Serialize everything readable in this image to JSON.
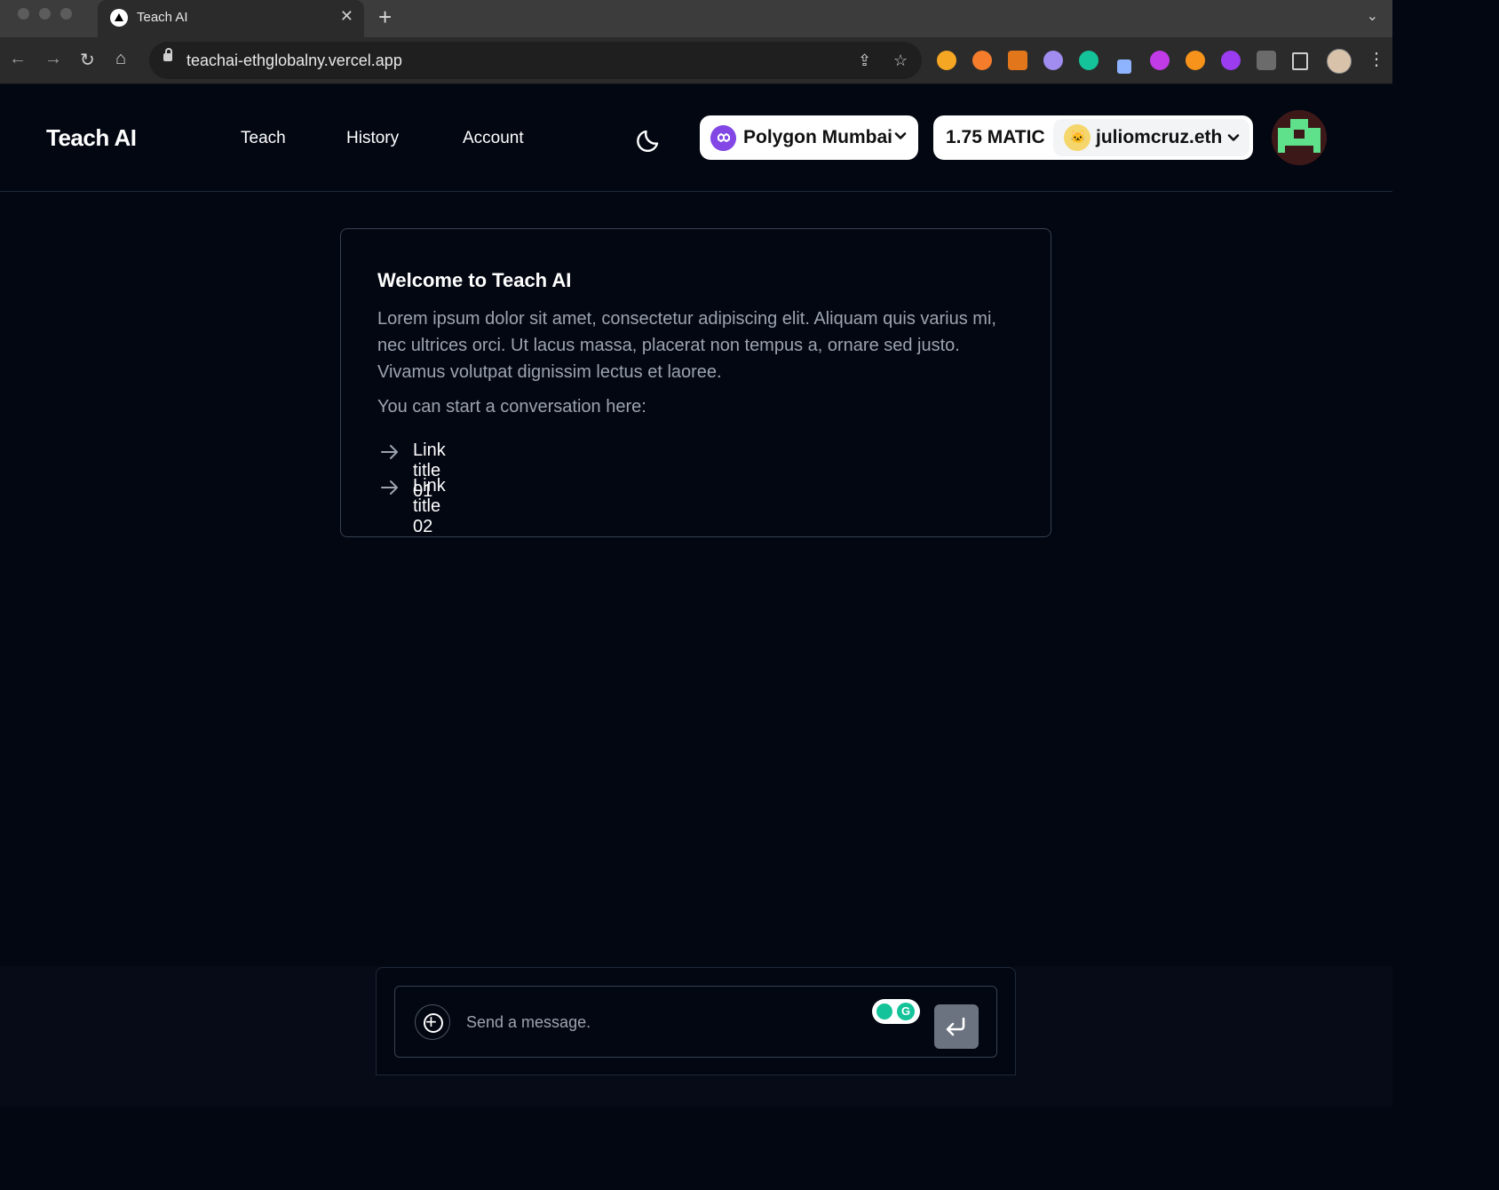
{
  "browser": {
    "tab_title": "Teach AI",
    "url": "teachai-ethglobalny.vercel.app"
  },
  "app": {
    "logo": "Teach AI",
    "nav": [
      {
        "label": "Teach"
      },
      {
        "label": "History"
      },
      {
        "label": "Account"
      }
    ],
    "network_label": "Polygon Mumbai",
    "balance": "1.75 MATIC",
    "ens_name": "juliomcruz.eth"
  },
  "welcome": {
    "title": "Welcome to Teach AI",
    "body": "Lorem ipsum dolor sit amet, consectetur adipiscing elit. Aliquam quis varius mi, nec ultrices orci. Ut lacus massa, placerat non tempus a, ornare sed justo. Vivamus volutpat dignissim lectus et laoree.",
    "prompt": "You can start a conversation here:",
    "links": [
      {
        "label": "Link title 01"
      },
      {
        "label": "Link title 02"
      }
    ]
  },
  "composer": {
    "placeholder": "Send a message."
  },
  "colors": {
    "page_bg": "#030712",
    "card_border": "#374151",
    "muted_text": "#9ca3af",
    "polygon_purple": "#8247e5",
    "send_button": "#6b7280",
    "avatar_green": "#5fe08a"
  }
}
